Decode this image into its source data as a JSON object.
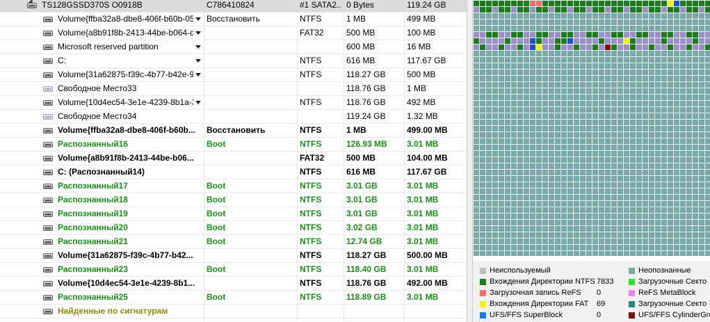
{
  "tree": {
    "rows": [
      {
        "name": "TS128GSSD370S O0918B",
        "col2": "C786410824",
        "col3": "#1 SATA2...",
        "col4": "0 Bytes",
        "col5": "119.24 GB",
        "indent": 60,
        "style": "normal",
        "icon": "drive",
        "selected": true,
        "expander": true,
        "dropdown": false
      },
      {
        "name": "Volume{ffba32a8-dbe8-406f-b60b-05...",
        "col2": "Восстановить",
        "col3": "NTFS",
        "col4": "1 MB",
        "col5": "499 MB",
        "indent": 83,
        "style": "normal",
        "icon": "drive",
        "dropdown": true
      },
      {
        "name": "Volume{a8b91f8b-2413-44be-b064-d...",
        "col2": "",
        "col3": "FAT32",
        "col4": "500 MB",
        "col5": "100 MB",
        "indent": 83,
        "style": "normal",
        "icon": "drive",
        "dropdown": true
      },
      {
        "name": "Microsoft reserved partition",
        "col2": "",
        "col3": "",
        "col4": "600 MB",
        "col5": "16 MB",
        "indent": 83,
        "style": "normal",
        "icon": "drive",
        "dropdown": true
      },
      {
        "name": "C:",
        "col2": "",
        "col3": "NTFS",
        "col4": "616 MB",
        "col5": "117.67 GB",
        "indent": 83,
        "style": "normal",
        "icon": "drive",
        "dropdown": true
      },
      {
        "name": "Volume{31a62875-f39c-4b77-b42e-90...",
        "col2": "",
        "col3": "NTFS",
        "col4": "118.27 GB",
        "col5": "500 MB",
        "indent": 83,
        "style": "normal",
        "icon": "drive",
        "dropdown": true
      },
      {
        "name": "Свободное Место33",
        "col2": "",
        "col3": "",
        "col4": "118.76 GB",
        "col5": "1 MB",
        "indent": 83,
        "style": "normal",
        "icon": "free",
        "dropdown": false
      },
      {
        "name": "Volume{10d4ec54-3e1e-4239-8b1a-3...",
        "col2": "",
        "col3": "NTFS",
        "col4": "118.76 GB",
        "col5": "492 MB",
        "indent": 83,
        "style": "normal",
        "icon": "drive",
        "dropdown": true
      },
      {
        "name": "Свободное Место34",
        "col2": "",
        "col3": "",
        "col4": "119.24 GB",
        "col5": "1.32 MB",
        "indent": 83,
        "style": "normal",
        "icon": "free",
        "dropdown": false
      },
      {
        "name": "Volume{ffba32a8-dbe8-406f-b60b...",
        "col2": "Восстановить",
        "col3": "NTFS",
        "col4": "1 MB",
        "col5": "499.00 MB",
        "indent": 83,
        "style": "bold",
        "icon": "drive",
        "dropdown": false
      },
      {
        "name": "Распознанный16",
        "col2": "Boot",
        "col3": "NTFS",
        "col4": "126.93 MB",
        "col5": "3.01 MB",
        "indent": 83,
        "style": "green",
        "icon": "drive",
        "dropdown": false
      },
      {
        "name": "Volume{a8b91f8b-2413-44be-b06...",
        "col2": "",
        "col3": "FAT32",
        "col4": "500 MB",
        "col5": "104.00 MB",
        "indent": 83,
        "style": "bold",
        "icon": "drive",
        "dropdown": false
      },
      {
        "name": "C: (Распознанный14)",
        "col2": "",
        "col3": "NTFS",
        "col4": "616 MB",
        "col5": "117.67 GB",
        "indent": 83,
        "style": "bold",
        "icon": "drive",
        "dropdown": false
      },
      {
        "name": "Распознанный17",
        "col2": "Boot",
        "col3": "NTFS",
        "col4": "3.01 GB",
        "col5": "3.01 MB",
        "indent": 83,
        "style": "green",
        "icon": "drive",
        "dropdown": false
      },
      {
        "name": "Распознанный18",
        "col2": "Boot",
        "col3": "NTFS",
        "col4": "3.01 GB",
        "col5": "3.01 MB",
        "indent": 83,
        "style": "green",
        "icon": "drive",
        "dropdown": false
      },
      {
        "name": "Распознанный19",
        "col2": "Boot",
        "col3": "NTFS",
        "col4": "3.01 GB",
        "col5": "3.01 MB",
        "indent": 83,
        "style": "green",
        "icon": "drive",
        "dropdown": false
      },
      {
        "name": "Распознанный20",
        "col2": "Boot",
        "col3": "NTFS",
        "col4": "3.02 GB",
        "col5": "3.01 MB",
        "indent": 83,
        "style": "green",
        "icon": "drive",
        "dropdown": false
      },
      {
        "name": "Распознанный21",
        "col2": "Boot",
        "col3": "NTFS",
        "col4": "12.74 GB",
        "col5": "3.01 MB",
        "indent": 83,
        "style": "green",
        "icon": "drive",
        "dropdown": false
      },
      {
        "name": "Volume{31a62875-f39c-4b77-b42...",
        "col2": "",
        "col3": "NTFS",
        "col4": "118.27 GB",
        "col5": "500.00 MB",
        "indent": 83,
        "style": "bold",
        "icon": "drive",
        "dropdown": false
      },
      {
        "name": "Распознанный23",
        "col2": "Boot",
        "col3": "NTFS",
        "col4": "118.40 GB",
        "col5": "3.01 MB",
        "indent": 83,
        "style": "green",
        "icon": "drive",
        "dropdown": false
      },
      {
        "name": "Volume{10d4ec54-3e1e-4239-8b1...",
        "col2": "",
        "col3": "NTFS",
        "col4": "118.76 GB",
        "col5": "492.00 MB",
        "indent": 83,
        "style": "bold",
        "icon": "drive",
        "dropdown": false
      },
      {
        "name": "Распознанный25",
        "col2": "Boot",
        "col3": "NTFS",
        "col4": "118.89 GB",
        "col5": "3.01 MB",
        "indent": 83,
        "style": "green",
        "icon": "drive",
        "dropdown": false
      },
      {
        "name": "Найденные по сигнатурам",
        "col2": "",
        "col3": "",
        "col4": "",
        "col5": "",
        "indent": 83,
        "style": "olive",
        "icon": "drive",
        "dropdown": false
      }
    ]
  },
  "legend": {
    "items": [
      {
        "label": "Неиспользуемый",
        "count": "",
        "color": "#c0c0c0",
        "column": "left"
      },
      {
        "label": "Вхождения Директории NTFS",
        "count": "7833",
        "color": "#1e7a1e",
        "column": "left"
      },
      {
        "label": "Загрузочная запись ReFS",
        "count": "0",
        "color": "#f07070",
        "column": "left"
      },
      {
        "label": "Вхождения Директории FAT",
        "count": "69",
        "color": "#f0f020",
        "column": "left"
      },
      {
        "label": "UFS/FFS SuperBlock",
        "count": "0",
        "color": "#1e78e0",
        "column": "left"
      },
      {
        "label": "Неопознанные",
        "count": "",
        "color": "#79a9a9",
        "column": "right"
      },
      {
        "label": "Загрузочные Секто",
        "count": "",
        "color": "#30e030",
        "column": "right"
      },
      {
        "label": "ReFS MetaBlock",
        "count": "",
        "color": "#f080f0",
        "column": "right"
      },
      {
        "label": "Загрузочные Секто",
        "count": "",
        "color": "#1e8a80",
        "column": "right"
      },
      {
        "label": "UFS/FFS CylinderGro",
        "count": "",
        "color": "#7a1010",
        "column": "right"
      }
    ]
  },
  "colors": {
    "ntfs_dir": "#1e7a1e",
    "unused": "#9a90c8",
    "unknown": "#79a9a9",
    "fat_dir": "#f0f020",
    "superblock": "#1e50c0",
    "red_mark": "#f07070",
    "dark_red": "#7a1010"
  }
}
